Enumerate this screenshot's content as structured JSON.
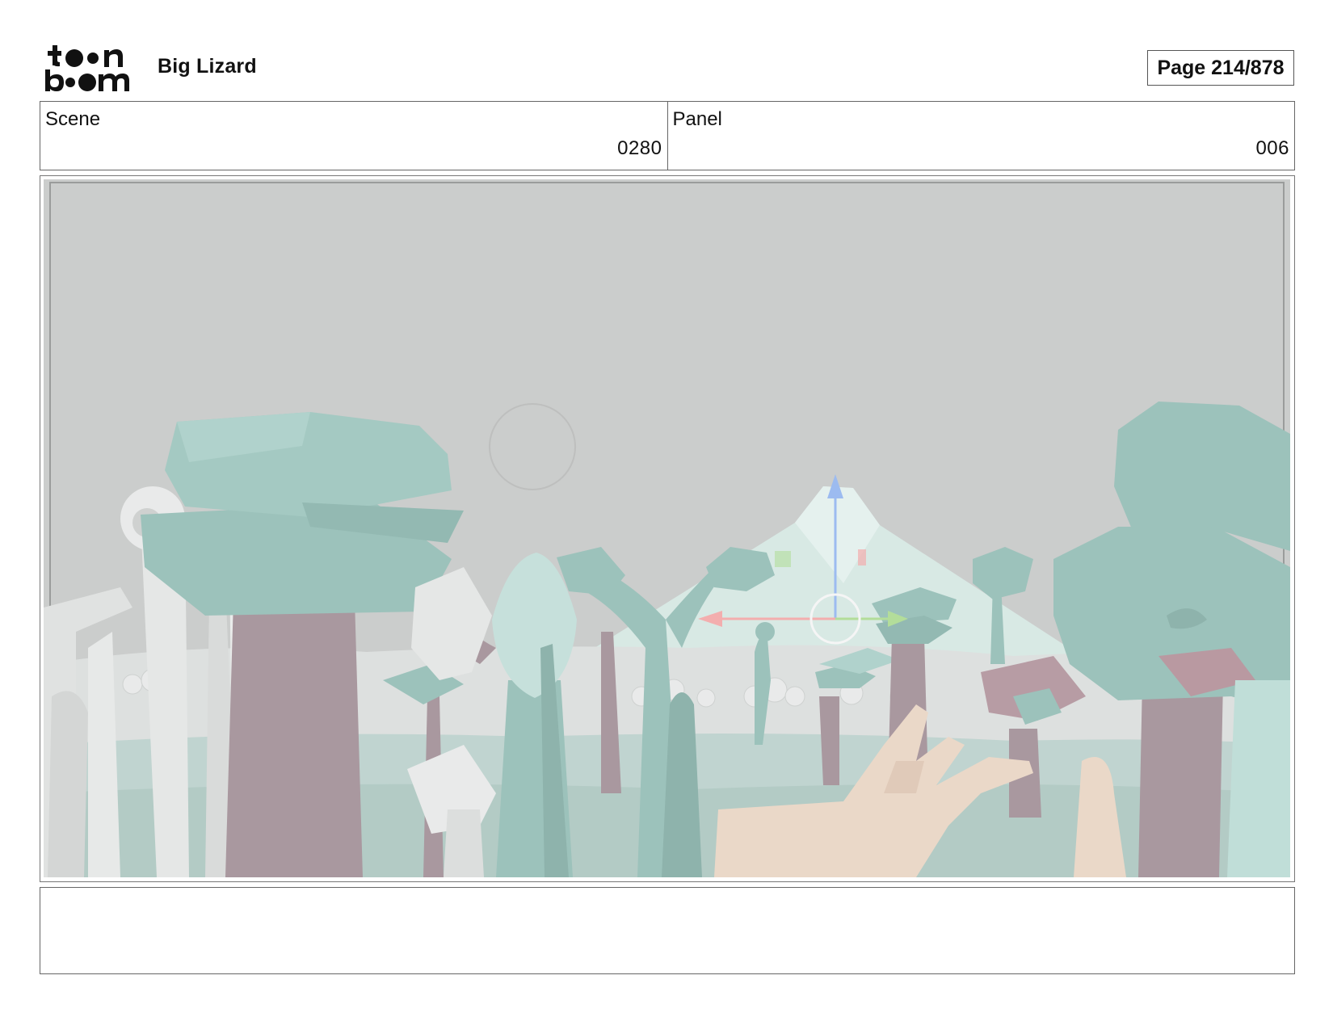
{
  "header": {
    "logo": {
      "text": "toon boom",
      "icon": "toon-boom-logo-icon"
    },
    "project_title": "Big Lizard",
    "page_label": "Page 214/878"
  },
  "info": {
    "scene_label": "Scene",
    "scene_value": "0280",
    "panel_label": "Panel",
    "panel_value": "006"
  },
  "panel": {
    "image_icon": "forest-scene-image",
    "colors": {
      "sky": "#c4c6c5",
      "foliage": "#8fbab2",
      "trunk": "#9e8a92",
      "skin": "#e8d3c1",
      "mountain": "#d3e6e1",
      "manipulator_x": "#f2a3a3",
      "manipulator_y": "#a9d98d",
      "manipulator_z": "#8fb2ee"
    }
  },
  "caption": {
    "text": ""
  }
}
